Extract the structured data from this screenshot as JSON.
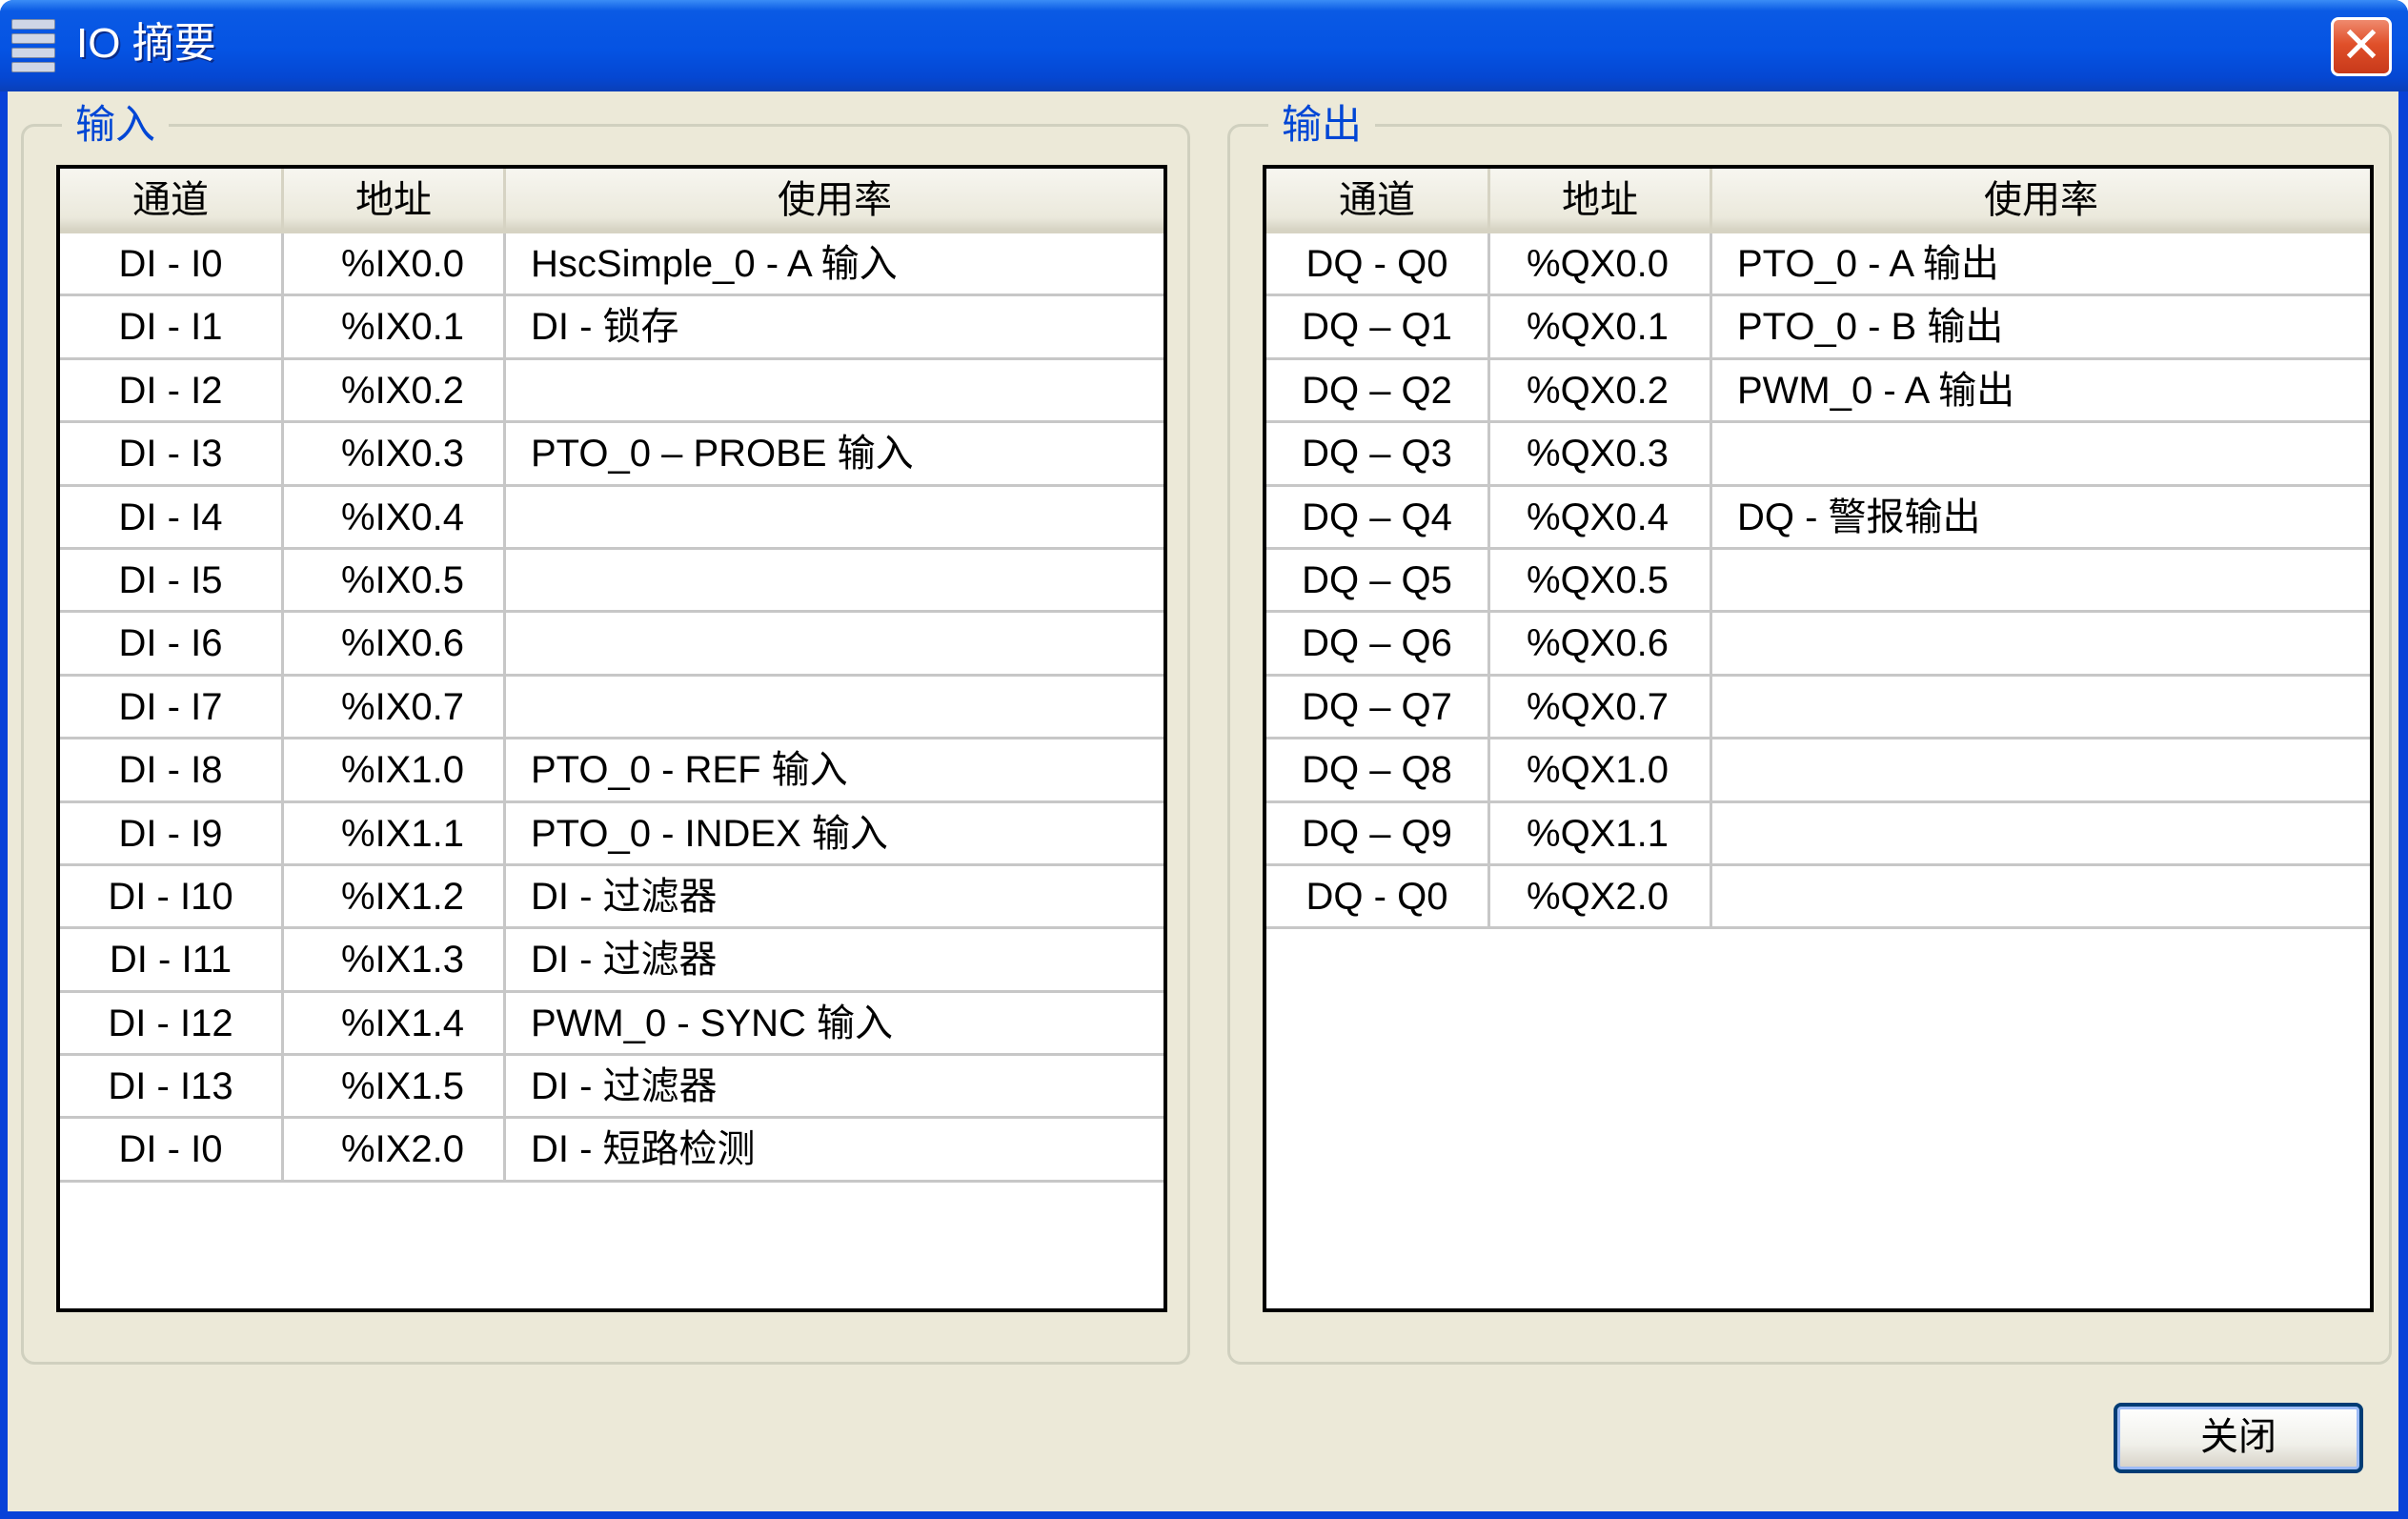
{
  "window": {
    "title": "IO 摘要",
    "close_icon": "✕"
  },
  "inputs": {
    "legend": "输入",
    "headers": [
      "通道",
      "地址",
      "使用率"
    ],
    "rows": [
      [
        "DI - I0",
        "%IX0.0",
        "HscSimple_0 - A 输入"
      ],
      [
        "DI - I1",
        "%IX0.1",
        "DI - 锁存"
      ],
      [
        "DI - I2",
        "%IX0.2",
        ""
      ],
      [
        "DI - I3",
        "%IX0.3",
        "PTO_0 – PROBE 输入"
      ],
      [
        "DI - I4",
        "%IX0.4",
        ""
      ],
      [
        "DI - I5",
        "%IX0.5",
        ""
      ],
      [
        "DI - I6",
        "%IX0.6",
        ""
      ],
      [
        "DI - I7",
        "%IX0.7",
        ""
      ],
      [
        "DI - I8",
        "%IX1.0",
        "PTO_0 - REF 输入"
      ],
      [
        "DI - I9",
        "%IX1.1",
        "PTO_0 - INDEX 输入"
      ],
      [
        "DI - I10",
        "%IX1.2",
        "DI - 过滤器"
      ],
      [
        "DI - I11",
        "%IX1.3",
        "DI - 过滤器"
      ],
      [
        "DI - I12",
        "%IX1.4",
        "PWM_0 - SYNC 输入"
      ],
      [
        "DI - I13",
        "%IX1.5",
        "DI - 过滤器"
      ],
      [
        "DI - I0",
        "%IX2.0",
        "DI - 短路检测"
      ]
    ]
  },
  "outputs": {
    "legend": "输出",
    "headers": [
      "通道",
      "地址",
      "使用率"
    ],
    "rows": [
      [
        "DQ - Q0",
        "%QX0.0",
        "PTO_0 - A 输出"
      ],
      [
        "DQ – Q1",
        "%QX0.1",
        "PTO_0 - B 输出"
      ],
      [
        "DQ – Q2",
        "%QX0.2",
        "PWM_0 - A 输出"
      ],
      [
        "DQ – Q3",
        "%QX0.3",
        ""
      ],
      [
        "DQ – Q4",
        "%QX0.4",
        "DQ - 警报输出"
      ],
      [
        "DQ – Q5",
        "%QX0.5",
        ""
      ],
      [
        "DQ – Q6",
        "%QX0.6",
        ""
      ],
      [
        "DQ – Q7",
        "%QX0.7",
        ""
      ],
      [
        "DQ – Q8",
        "%QX1.0",
        ""
      ],
      [
        "DQ – Q9",
        "%QX1.1",
        ""
      ],
      [
        "DQ - Q0",
        "%QX2.0",
        ""
      ]
    ]
  },
  "footer": {
    "close_label": "关闭"
  }
}
